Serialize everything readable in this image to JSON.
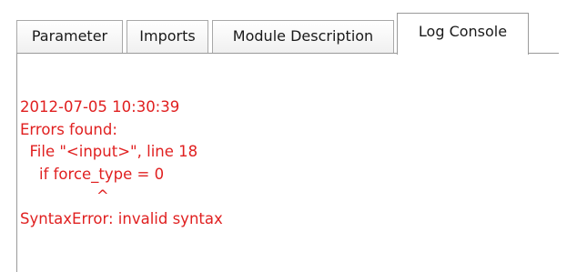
{
  "tabs": [
    {
      "label": "Parameter",
      "active": false
    },
    {
      "label": "Imports",
      "active": false
    },
    {
      "label": "Module Description",
      "active": false
    },
    {
      "label": "Log Console",
      "active": true
    }
  ],
  "log_console": {
    "text_color": "#e02020",
    "lines": [
      "2012-07-05 10:30:39",
      "Errors found:",
      "  File \"<input>\", line 18",
      "    if force_type = 0",
      "                ^",
      "SyntaxError: invalid syntax"
    ]
  }
}
